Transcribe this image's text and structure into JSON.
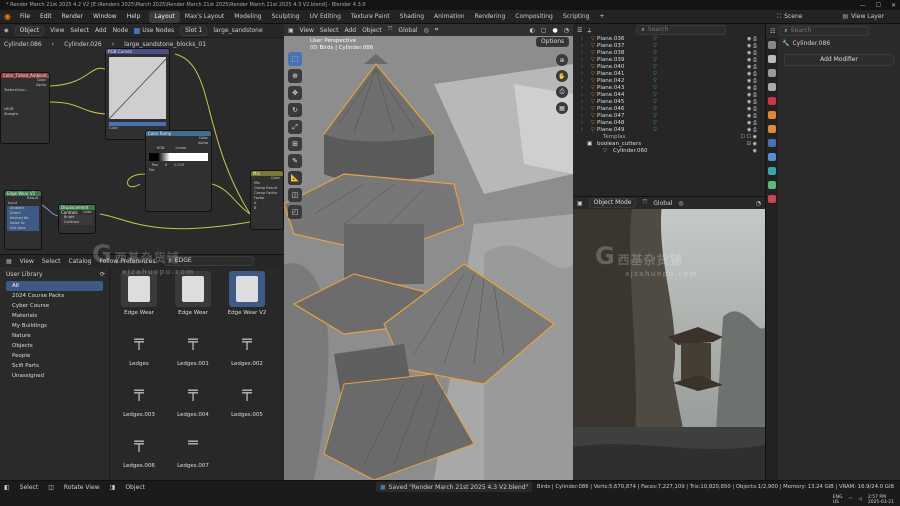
{
  "title_bar": {
    "text": "* Render March 21st 2025 4.2 V2 [E:\\Renders 2025\\March 2025\\Render March 21st 2025\\Render March 21st 2025 4.3 V2.blend] - Blender 4.3.0",
    "controls": [
      "—",
      "☐",
      "✕"
    ]
  },
  "menu": [
    "File",
    "Edit",
    "Render",
    "Window",
    "Help"
  ],
  "workspaces": [
    "Layout",
    "Max's Layout",
    "Modeling",
    "Sculpting",
    "UV Editing",
    "Texture Paint",
    "Shading",
    "Animation",
    "Rendering",
    "Compositing",
    "Scripting"
  ],
  "workspace_add": "+",
  "scene": {
    "label": "Scene",
    "view_layer": "View Layer"
  },
  "node_editor": {
    "mode": "Object",
    "menus": [
      "View",
      "Select",
      "Add",
      "Node"
    ],
    "use_nodes_label": "Use Nodes",
    "slot": "Slot 1",
    "material": "large_sandstone",
    "breadcrumb": [
      "Cylinder.086",
      "Cylinder.026",
      "large_sandstone_blocks_01"
    ],
    "nodes": {
      "texture": {
        "title": "Color_Tinted_Ambient_Occlusion",
        "rows": [
          "Color",
          "Alpha",
          "TextureCoor...",
          "sRGB",
          "Straight"
        ]
      },
      "curve": {
        "title": "RGB Curves",
        "rows": [
          "Color"
        ]
      },
      "ramp": {
        "title": "Color Ramp",
        "rows": [
          "Color",
          "Alpha",
          "Fac",
          "RGB",
          "Linear",
          "Pos",
          "0",
          "0.370"
        ]
      },
      "edge_wear": {
        "title": "Edge Wear V2",
        "rows": [
          "Result",
          "Input",
          "Ambient",
          "Direct",
          "Normal Wc",
          "Noise Sc",
          "Dirt Amo",
          "Dirt Roug"
        ]
      },
      "displacement": {
        "title": "Displacement Controls",
        "rows": [
          "Color",
          "Bright",
          "Contrast"
        ]
      },
      "mix": {
        "title": "Mix",
        "rows": [
          "Color",
          "Mix",
          "Clamp Result",
          "Clamp Factor",
          "Factor",
          "A",
          "B"
        ]
      }
    }
  },
  "asset_browser": {
    "menus": [
      "View",
      "Select",
      "Catalog"
    ],
    "follow_prefs": "Follow Preferences",
    "search": "EDGE",
    "library": "User Library",
    "catalogs": [
      "All",
      "2024 Course Packs",
      "Cyber Course",
      "Materials",
      "My Buildings",
      "Nature",
      "Objects",
      "People",
      "Scifi Parts",
      "Unassigned"
    ],
    "assets": [
      "Edge Wear",
      "Edge Wear",
      "Edge Wear V2",
      "Ledges",
      "Ledges.001",
      "Ledges.002",
      "Ledges.003",
      "Ledges.004",
      "Ledges.005",
      "Ledges.006",
      "Ledges.007"
    ]
  },
  "viewport": {
    "menus": [
      "View",
      "Select",
      "Add",
      "Object"
    ],
    "transform": "Global",
    "overlay_title": "User Perspective",
    "overlay_sub": "(0) Birds | Cylinder.086",
    "options": "Options"
  },
  "outliner": {
    "search_placeholder": "Search",
    "items": [
      "Plane.036",
      "Plane.037",
      "Plane.038",
      "Plane.039",
      "Plane.040",
      "Plane.041",
      "Plane.042",
      "Plane.043",
      "Plane.044",
      "Plane.045",
      "Plane.046",
      "Plane.047",
      "Plane.048",
      "Plane.049"
    ],
    "collections": [
      "Templas",
      "boolean_cutters",
      "Cylinder.060"
    ]
  },
  "render_view": {
    "mode": "Object Mode",
    "transform": "Global"
  },
  "properties": {
    "search_placeholder": "Search",
    "object": "Cylinder.086",
    "add_modifier": "Add Modifier"
  },
  "status_bar": {
    "left": [
      "Select",
      "Rotate View",
      "Object"
    ],
    "message": "Saved \"Render March 21st 2025 4.3 V2.blend\"",
    "stats": "Birds | Cylinder.086 | Verts:5,670,874 | Faces:7,227,109 | Tris:10,820,850 | Objects:1/2,900 | Memory: 13.24 GiB | VRAM: 16.9/24.0 GiB",
    "lang": "ENG\nUS",
    "clock": "2:57 PM\n2025-03-21"
  },
  "watermark": {
    "cn": "西基杂货铺",
    "url": "xjzahuopu.com",
    "letter": "G"
  },
  "colors": {
    "accent": "#4772b3",
    "selection": "#e8a23a",
    "green": "#5bb87a",
    "orange": "#e08a3c"
  }
}
